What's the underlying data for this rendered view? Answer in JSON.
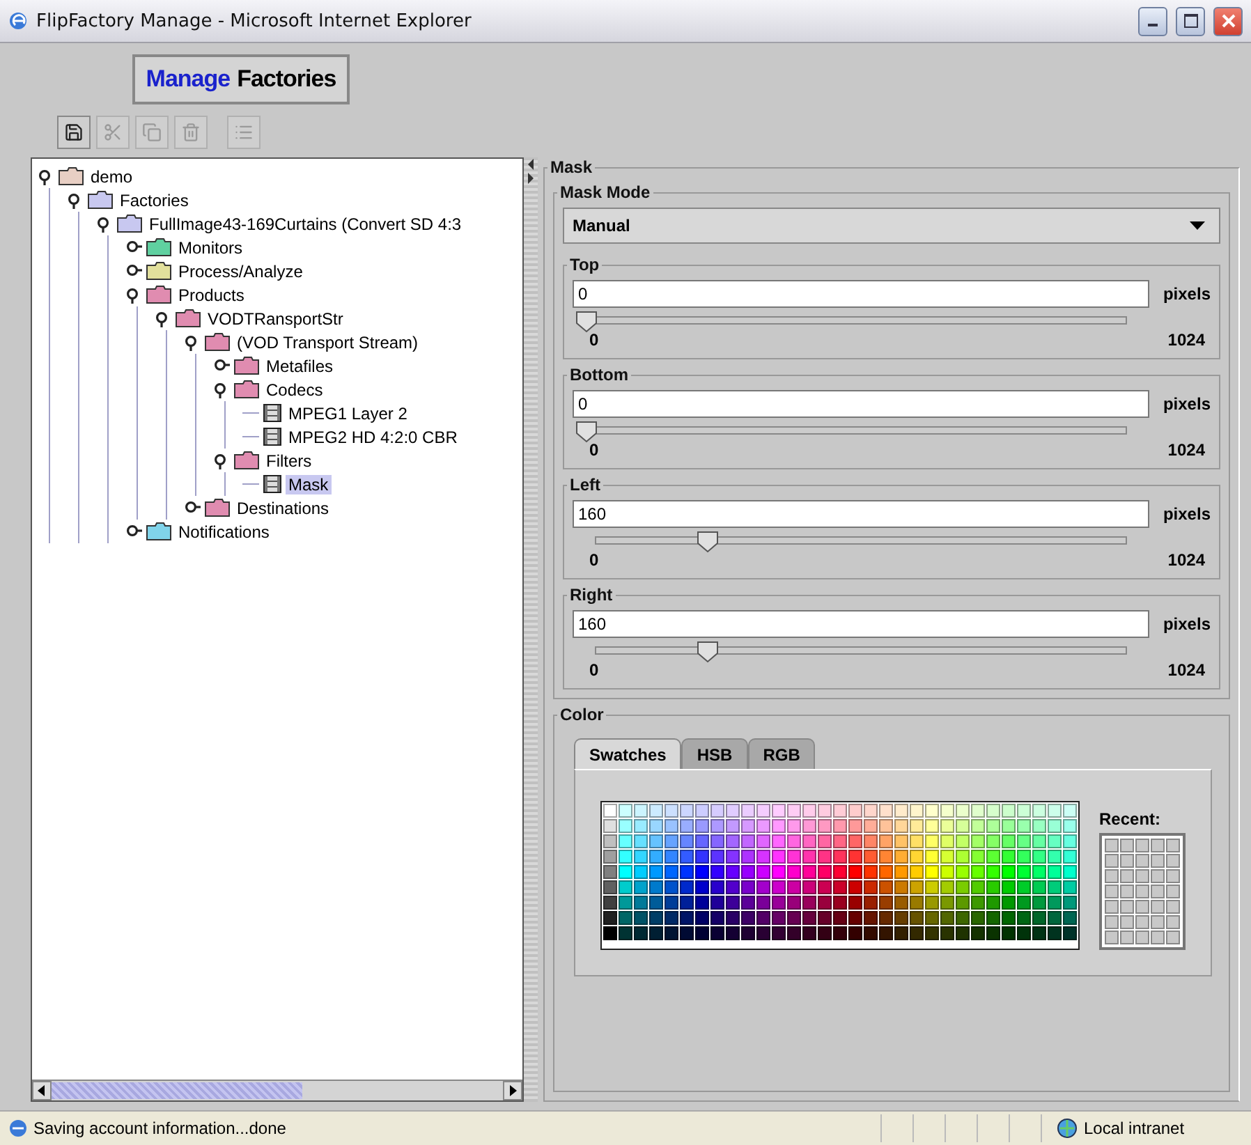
{
  "window": {
    "title": "FlipFactory Manage - Microsoft Internet Explorer"
  },
  "header": {
    "accent": "Manage",
    "title": "Factories"
  },
  "toolbar": [
    {
      "kind": "save",
      "disabled": false
    },
    {
      "kind": "cut",
      "disabled": true
    },
    {
      "kind": "copy",
      "disabled": true
    },
    {
      "kind": "delete",
      "disabled": true
    },
    {
      "kind": "properties",
      "disabled": true
    }
  ],
  "tree": [
    {
      "label": "demo",
      "kind": "folder",
      "color": "#e8cfc4",
      "expanded": true,
      "selected": false,
      "children": [
        {
          "label": "Factories",
          "kind": "folder",
          "color": "#c8c8f0",
          "expanded": true,
          "selected": false,
          "children": [
            {
              "label": "FullImage43-169Curtains (Convert SD 4:3",
              "kind": "folder",
              "color": "#c8c8f0",
              "expanded": true,
              "selected": false,
              "children": [
                {
                  "label": "Monitors",
                  "kind": "folder",
                  "color": "#5fd0a0",
                  "expanded": false,
                  "selected": false
                },
                {
                  "label": "Process/Analyze",
                  "kind": "folder",
                  "color": "#e2e09c",
                  "expanded": false,
                  "selected": false
                },
                {
                  "label": "Products",
                  "kind": "folder",
                  "color": "#e08cb0",
                  "expanded": true,
                  "selected": false,
                  "children": [
                    {
                      "label": "VODTRansportStr",
                      "kind": "folder",
                      "color": "#e08cb0",
                      "expanded": true,
                      "selected": false,
                      "children": [
                        {
                          "label": "(VOD Transport Stream)",
                          "kind": "folder",
                          "color": "#e08cb0",
                          "expanded": true,
                          "selected": false,
                          "children": [
                            {
                              "label": "Metafiles",
                              "kind": "folder",
                              "color": "#e08cb0",
                              "expanded": false,
                              "selected": false
                            },
                            {
                              "label": "Codecs",
                              "kind": "folder",
                              "color": "#e08cb0",
                              "expanded": true,
                              "selected": false,
                              "children": [
                                {
                                  "label": "MPEG1 Layer 2",
                                  "kind": "leaf",
                                  "selected": false
                                },
                                {
                                  "label": "MPEG2 HD 4:2:0 CBR",
                                  "kind": "leaf",
                                  "selected": false
                                }
                              ]
                            },
                            {
                              "label": "Filters",
                              "kind": "folder",
                              "color": "#e08cb0",
                              "expanded": true,
                              "selected": false,
                              "children": [
                                {
                                  "label": "Mask",
                                  "kind": "leaf",
                                  "selected": true
                                }
                              ]
                            }
                          ]
                        },
                        {
                          "label": "Destinations",
                          "kind": "folder",
                          "color": "#e08cb0",
                          "expanded": false,
                          "selected": false
                        }
                      ]
                    }
                  ]
                },
                {
                  "label": "Notifications",
                  "kind": "folder",
                  "color": "#80d4ea",
                  "expanded": false,
                  "selected": false
                }
              ]
            }
          ]
        }
      ]
    }
  ],
  "panel": {
    "title": "Mask",
    "mode": {
      "title": "Mask Mode",
      "value": "Manual"
    },
    "edges": [
      {
        "title": "Top",
        "value": "0",
        "unit": "pixels",
        "level": 0,
        "min_label": "0",
        "max_label": "1024"
      },
      {
        "title": "Bottom",
        "value": "0",
        "unit": "pixels",
        "level": 0,
        "min_label": "0",
        "max_label": "1024"
      },
      {
        "title": "Left",
        "value": "160",
        "unit": "pixels",
        "level": 0.23,
        "min_label": "0",
        "max_label": "1024"
      },
      {
        "title": "Right",
        "value": "160",
        "unit": "pixels",
        "level": 0.23,
        "min_label": "0",
        "max_label": "1024"
      }
    ],
    "color": {
      "title": "Color",
      "tabs": [
        {
          "label": "Swatches",
          "selected": true
        },
        {
          "label": "HSB",
          "selected": false
        },
        {
          "label": "RGB",
          "selected": false
        }
      ],
      "recent_label": "Recent:"
    }
  },
  "status_bar": {
    "message": "Saving account information...done",
    "zone": "Local intranet"
  }
}
